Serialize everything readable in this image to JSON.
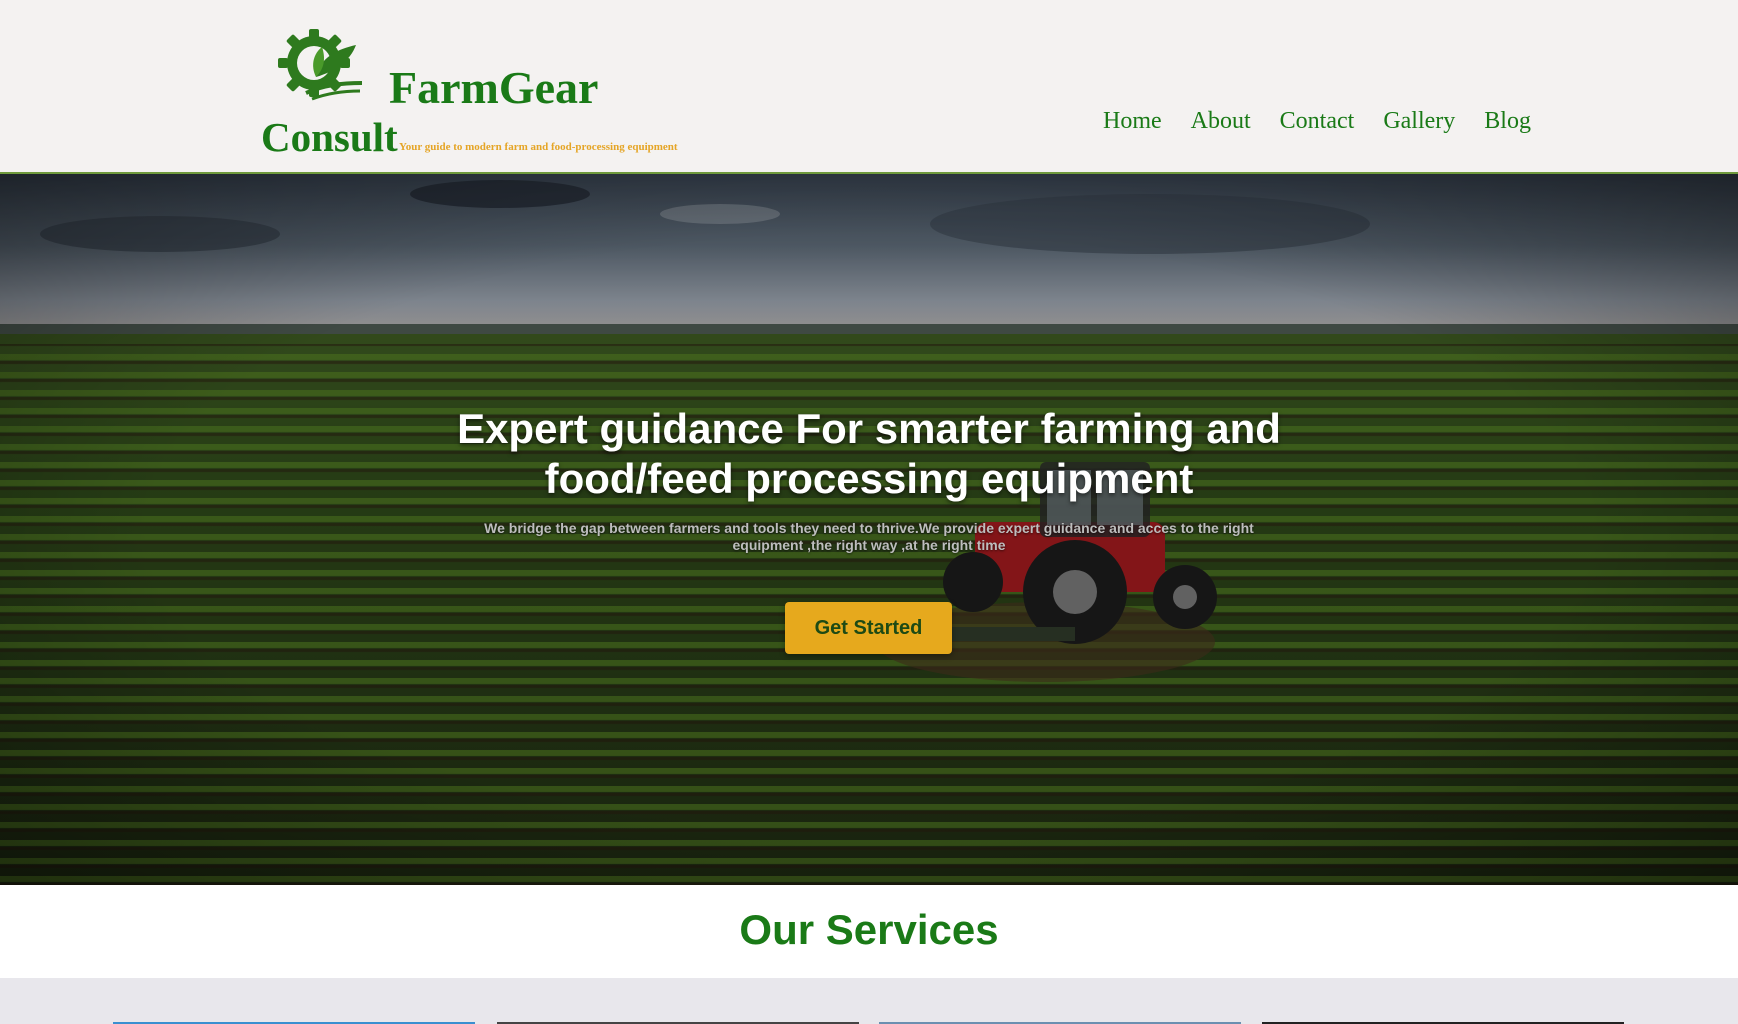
{
  "brand": {
    "name_line1": "FarmGear",
    "name_line2": "Consult",
    "tagline": "Your guide to modern farm and food-processing equipment",
    "logo_icon": "gear-leaf-icon",
    "primary_color": "#1a7a17",
    "accent_color": "#e5a526"
  },
  "nav": {
    "items": [
      {
        "label": "Home"
      },
      {
        "label": "About"
      },
      {
        "label": "Contact"
      },
      {
        "label": "Gallery"
      },
      {
        "label": "Blog"
      }
    ]
  },
  "hero": {
    "title": "Expert guidance For smarter farming and food/feed processing equipment",
    "subtitle": "We bridge the gap between farmers and tools they need to thrive.We provide expert guidance and acces to the right equipment ,the right way ,at he right time",
    "cta_label": "Get Started",
    "cta_color": "#e6a91d"
  },
  "services": {
    "title": "Our Services",
    "card_accent_colors": [
      "#3a8fd0",
      "#444444",
      "#6b8fb0",
      "#222222"
    ]
  }
}
